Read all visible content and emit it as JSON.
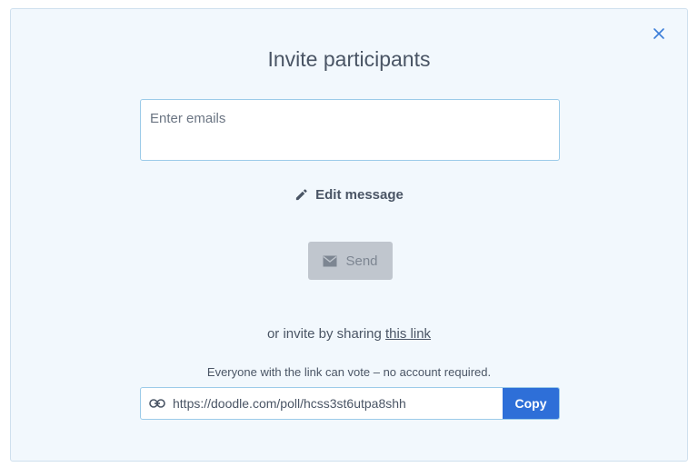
{
  "dialog": {
    "title": "Invite participants",
    "emails": {
      "placeholder": "Enter emails",
      "value": ""
    },
    "edit_message_label": "Edit message",
    "send_label": "Send",
    "or_invite_text": "or invite by sharing",
    "this_link_label": "this link",
    "everyone_note": "Everyone with the link can vote – no account required.",
    "poll_url": "https://doodle.com/poll/hcss3st6utpa8shh",
    "copy_label": "Copy"
  },
  "icons": {
    "close": "close-icon",
    "edit": "pencil-icon",
    "send": "envelope-icon",
    "link": "link-icon"
  },
  "colors": {
    "accent": "#2e6fd8",
    "close_icon": "#3b7dd8",
    "panel_background": "#f2f8fd",
    "disabled_button": "#c0c6ce"
  }
}
